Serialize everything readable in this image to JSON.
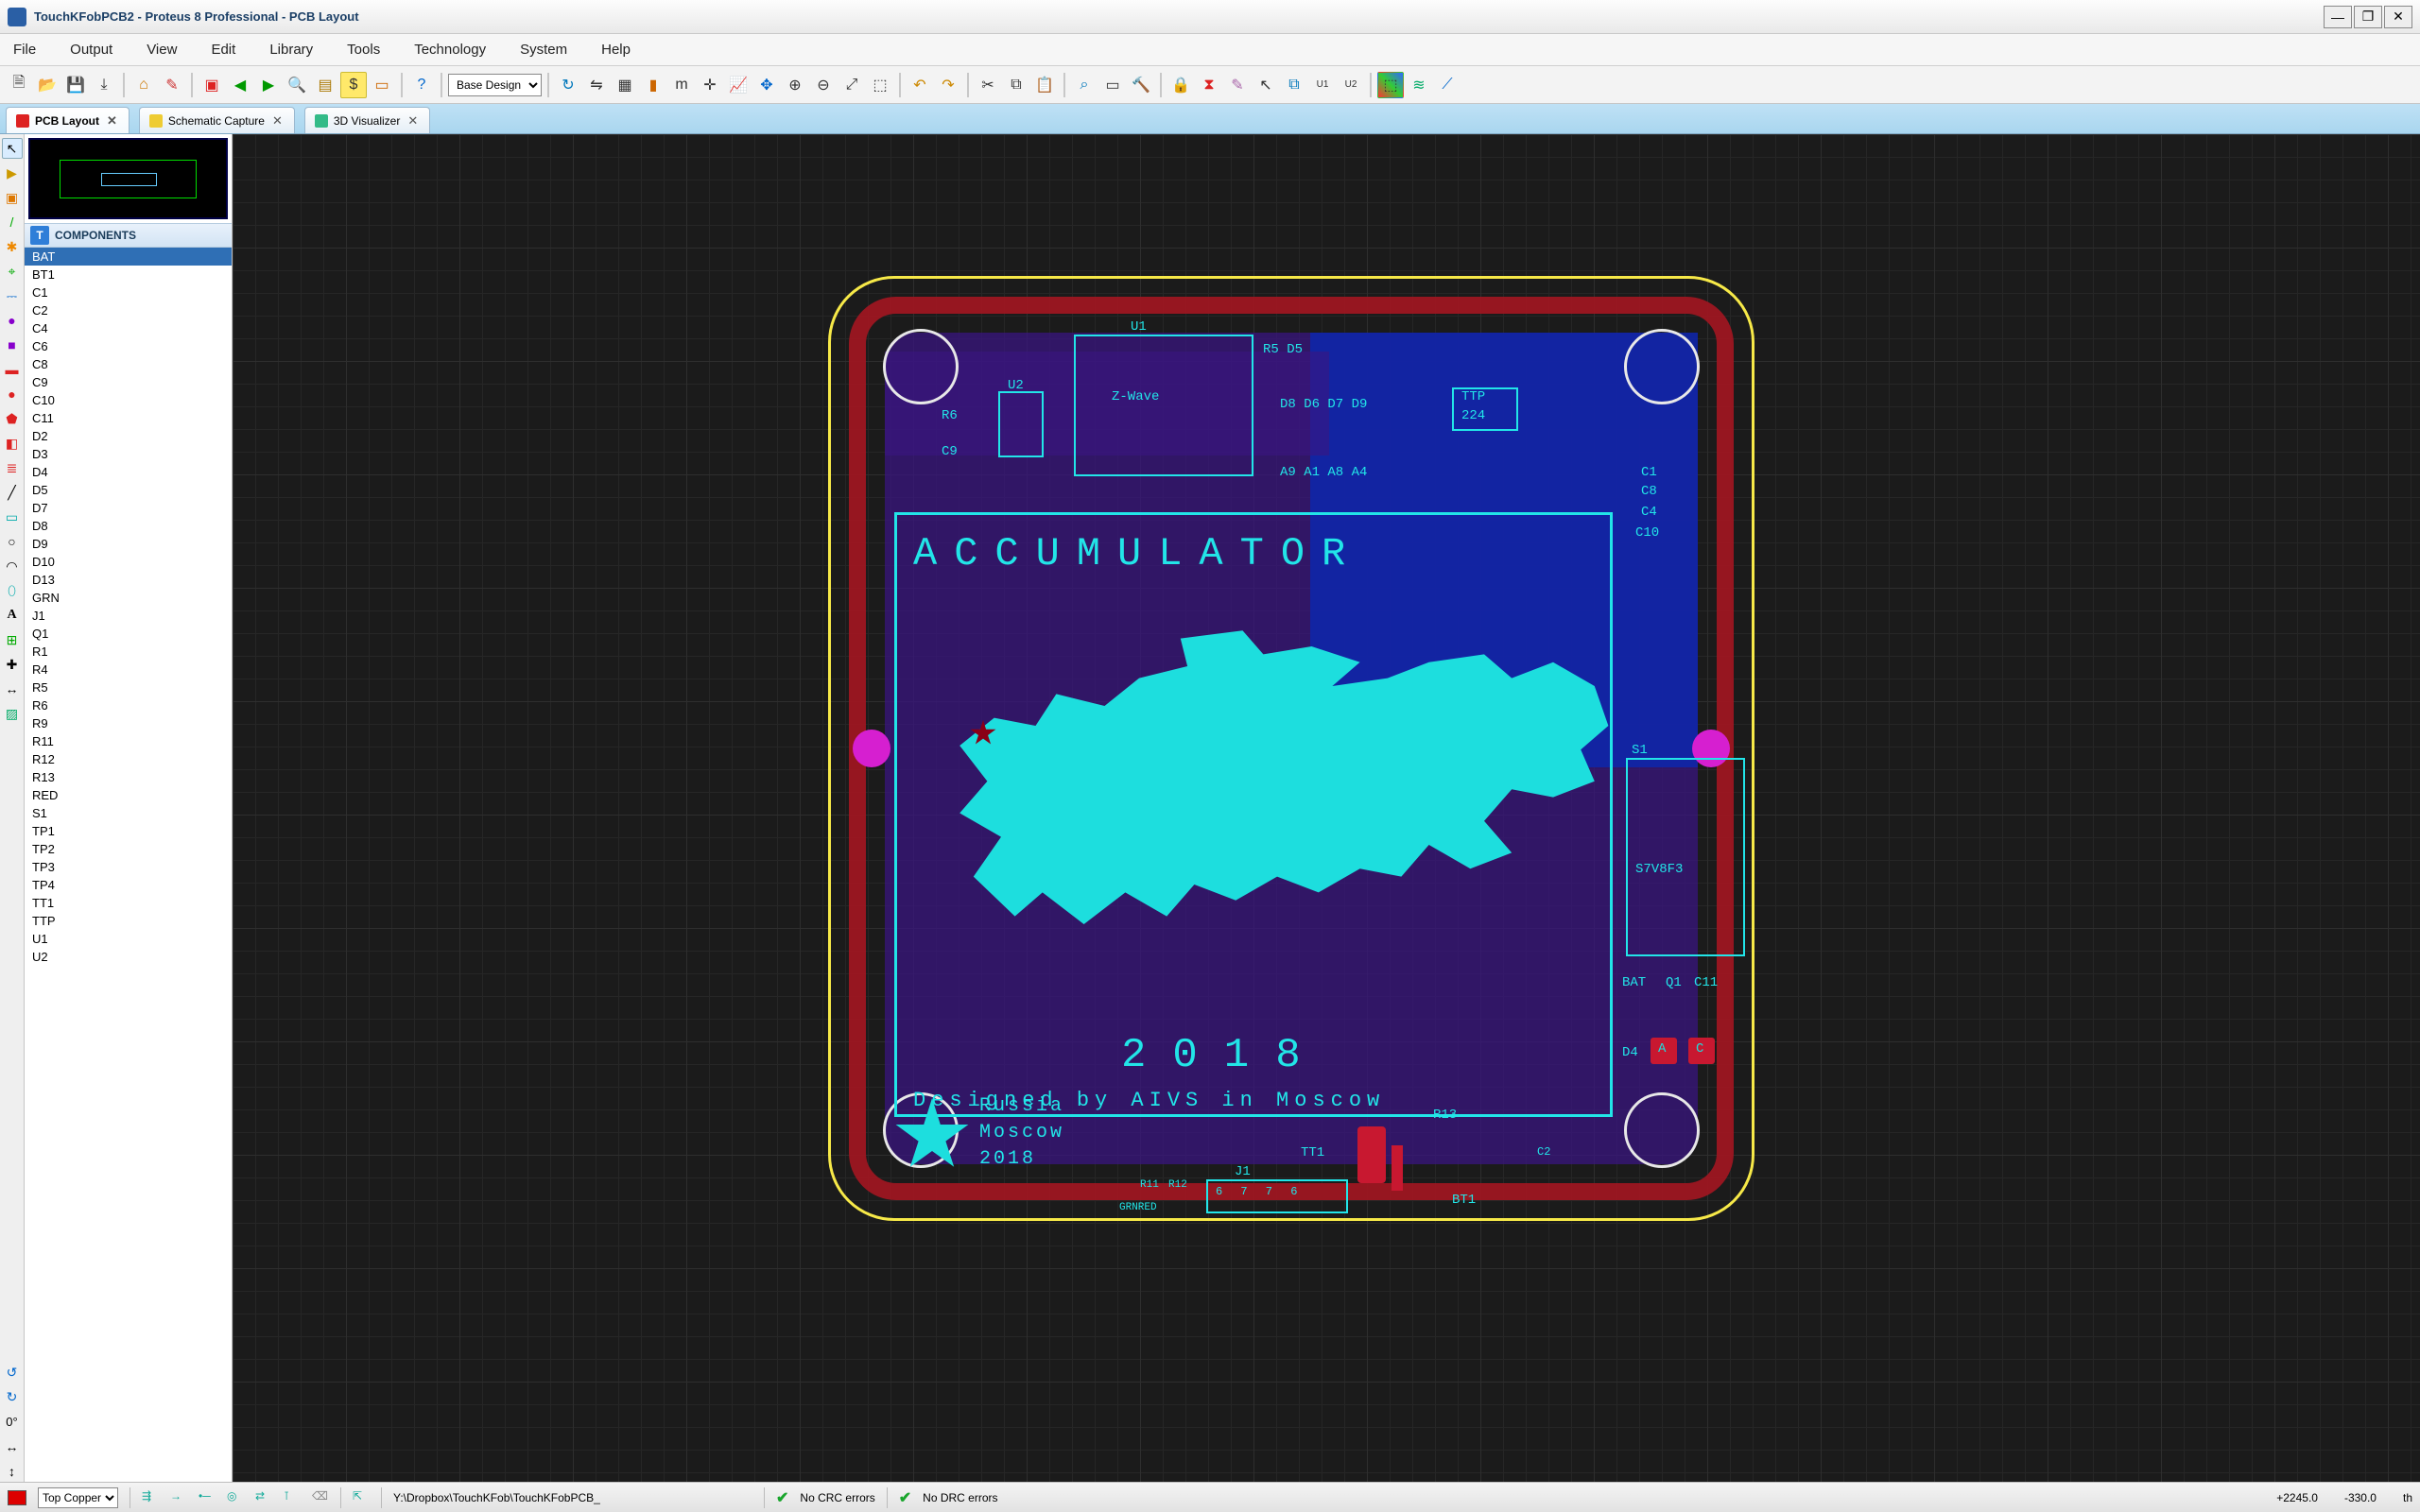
{
  "title_bar": {
    "text": "TouchKFobPCB2 - Proteus 8 Professional - PCB Layout"
  },
  "menu": [
    "File",
    "Output",
    "View",
    "Edit",
    "Library",
    "Tools",
    "Technology",
    "System",
    "Help"
  ],
  "toolbar_combo": {
    "value": "Base Design"
  },
  "tabs": [
    {
      "label": "PCB Layout",
      "active": true
    },
    {
      "label": "Schematic Capture",
      "active": false
    },
    {
      "label": "3D Visualizer",
      "active": false
    }
  ],
  "side_panel": {
    "header": "COMPONENTS",
    "selected": "BAT",
    "items": [
      "BAT",
      "BT1",
      "C1",
      "C2",
      "C4",
      "C6",
      "C8",
      "C9",
      "C10",
      "C11",
      "D2",
      "D3",
      "D4",
      "D5",
      "D7",
      "D8",
      "D9",
      "D10",
      "D13",
      "GRN",
      "J1",
      "Q1",
      "R1",
      "R4",
      "R5",
      "R6",
      "R9",
      "R11",
      "R12",
      "R13",
      "RED",
      "S1",
      "TP1",
      "TP2",
      "TP3",
      "TP4",
      "TT1",
      "TTP",
      "U1",
      "U2"
    ]
  },
  "angle_label": "0°",
  "board": {
    "accu_title": "ACCUMULATOR",
    "year": "2018",
    "designed": "Designed by AIVS in Moscow",
    "corner1": "Russia",
    "corner2": "Moscow",
    "corner3": "2018",
    "labels": {
      "u1": "U1",
      "u2": "U2",
      "zwave": "Z-Wave",
      "r5d5": "R5 D5",
      "r6": "R6",
      "c9": "C9",
      "d8679": "D8 D6 D7 D9",
      "ttp": "TTP",
      "ttp224": "224",
      "a9184": "A9 A1 A8 A4",
      "c1r": "C1",
      "c8r": "C8",
      "c4r": "C4",
      "c10r": "C10",
      "s1": "S1",
      "s7v8f3": "S7V8F3",
      "bat": "BAT",
      "q1": "Q1",
      "c11": "C11",
      "d4": "D4",
      "a": "A",
      "c": "C",
      "r13": "R13",
      "tt1": "TT1",
      "j1": "J1",
      "r11": "R11",
      "r12": "R12",
      "c2": "C2",
      "bt1": "BT1",
      "grnred": "GRNRED",
      "nums": "6 7 7 6"
    }
  },
  "status": {
    "layer": "Top Copper",
    "path": "Y:\\Dropbox\\TouchKFob\\TouchKFobPCB_",
    "crc": "No CRC errors",
    "drc": "No DRC errors",
    "x": "+2245.0",
    "y": "-330.0",
    "unit": "th"
  }
}
